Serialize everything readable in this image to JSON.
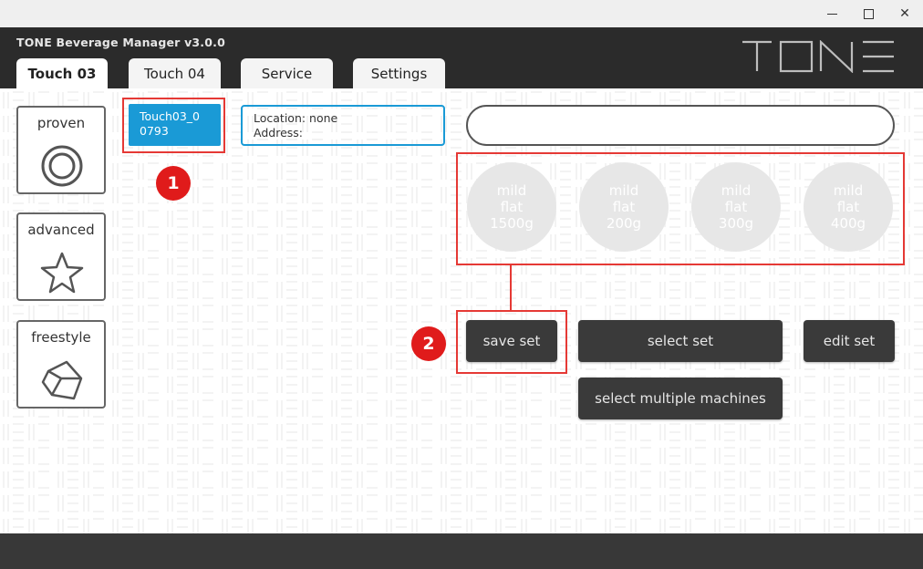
{
  "window": {
    "controls": {
      "minimize_icon": "minimize-icon",
      "maximize_icon": "maximize-icon",
      "close_icon": "close-icon"
    }
  },
  "header": {
    "app_title": "TONE Beverage Manager v3.0.0",
    "logo_text": "TONE",
    "tabs": [
      {
        "label": "Touch 03",
        "active": true
      },
      {
        "label": "Touch 04",
        "active": false
      },
      {
        "label": "Service",
        "active": false
      },
      {
        "label": "Settings",
        "active": false
      }
    ]
  },
  "modes": [
    {
      "label": "proven",
      "icon": "target-icon"
    },
    {
      "label": "advanced",
      "icon": "star-icon"
    },
    {
      "label": "freestyle",
      "icon": "polyhedron-icon"
    }
  ],
  "machine": {
    "id_line1": "Touch03_0",
    "id_line2": "0793"
  },
  "location_box": {
    "location_label": "Location: none",
    "address_label": "Address:"
  },
  "drinks": [
    {
      "line1": "mild",
      "line2": "flat",
      "line3": "1500g"
    },
    {
      "line1": "mild",
      "line2": "flat",
      "line3": "200g"
    },
    {
      "line1": "mild",
      "line2": "flat",
      "line3": "300g"
    },
    {
      "line1": "mild",
      "line2": "flat",
      "line3": "400g"
    }
  ],
  "actions": {
    "save_set": "save set",
    "select_set": "select set",
    "edit_set": "edit set",
    "select_multiple": "select multiple machines"
  },
  "annotations": {
    "badge1": "1",
    "badge2": "2"
  },
  "colors": {
    "accent": "#1a9ad6",
    "header_bg": "#2b2b2b",
    "annotation_red": "#e53935",
    "button_dark": "#3a3a3a"
  }
}
